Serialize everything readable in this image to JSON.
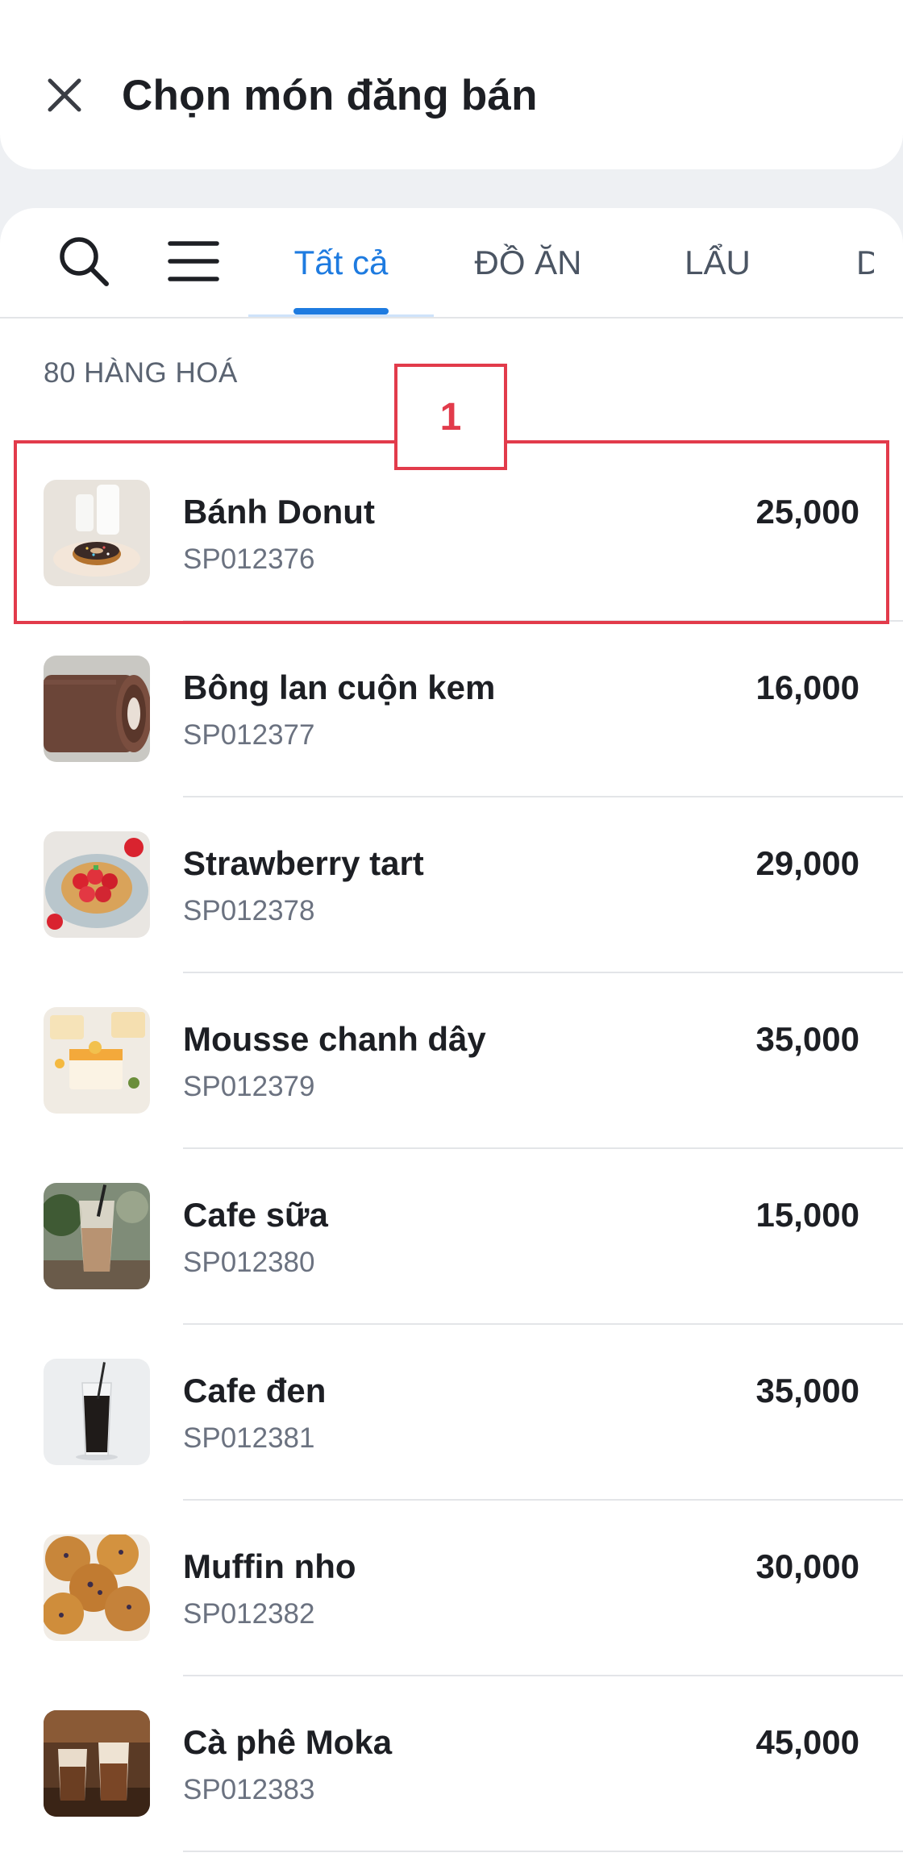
{
  "header": {
    "title": "Chọn món đăng bán",
    "close_icon": "close-icon"
  },
  "toolbar": {
    "search_icon": "search-icon",
    "menu_icon": "menu-icon"
  },
  "tabs": [
    {
      "label": "Tất cả",
      "active": true
    },
    {
      "label": "ĐỒ ĂN",
      "active": false
    },
    {
      "label": "LẨU",
      "active": false
    },
    {
      "label": "D",
      "active": false
    }
  ],
  "item_count_label": "80 HÀNG HOÁ",
  "items": [
    {
      "name": "Bánh Donut",
      "code": "SP012376",
      "price": "25,000"
    },
    {
      "name": "Bông lan cuộn kem",
      "code": "SP012377",
      "price": "16,000"
    },
    {
      "name": "Strawberry tart",
      "code": "SP012378",
      "price": "29,000"
    },
    {
      "name": "Mousse chanh dây",
      "code": "SP012379",
      "price": "35,000"
    },
    {
      "name": "Cafe sữa",
      "code": "SP012380",
      "price": "15,000"
    },
    {
      "name": "Cafe đen",
      "code": "SP012381",
      "price": "35,000"
    },
    {
      "name": "Muffin nho",
      "code": "SP012382",
      "price": "30,000"
    },
    {
      "name": "Cà phê Moka",
      "code": "SP012383",
      "price": "45,000"
    }
  ],
  "annotation": {
    "marker": "1"
  },
  "colors": {
    "accent": "#1e7be0",
    "highlight": "#e23b4b"
  }
}
